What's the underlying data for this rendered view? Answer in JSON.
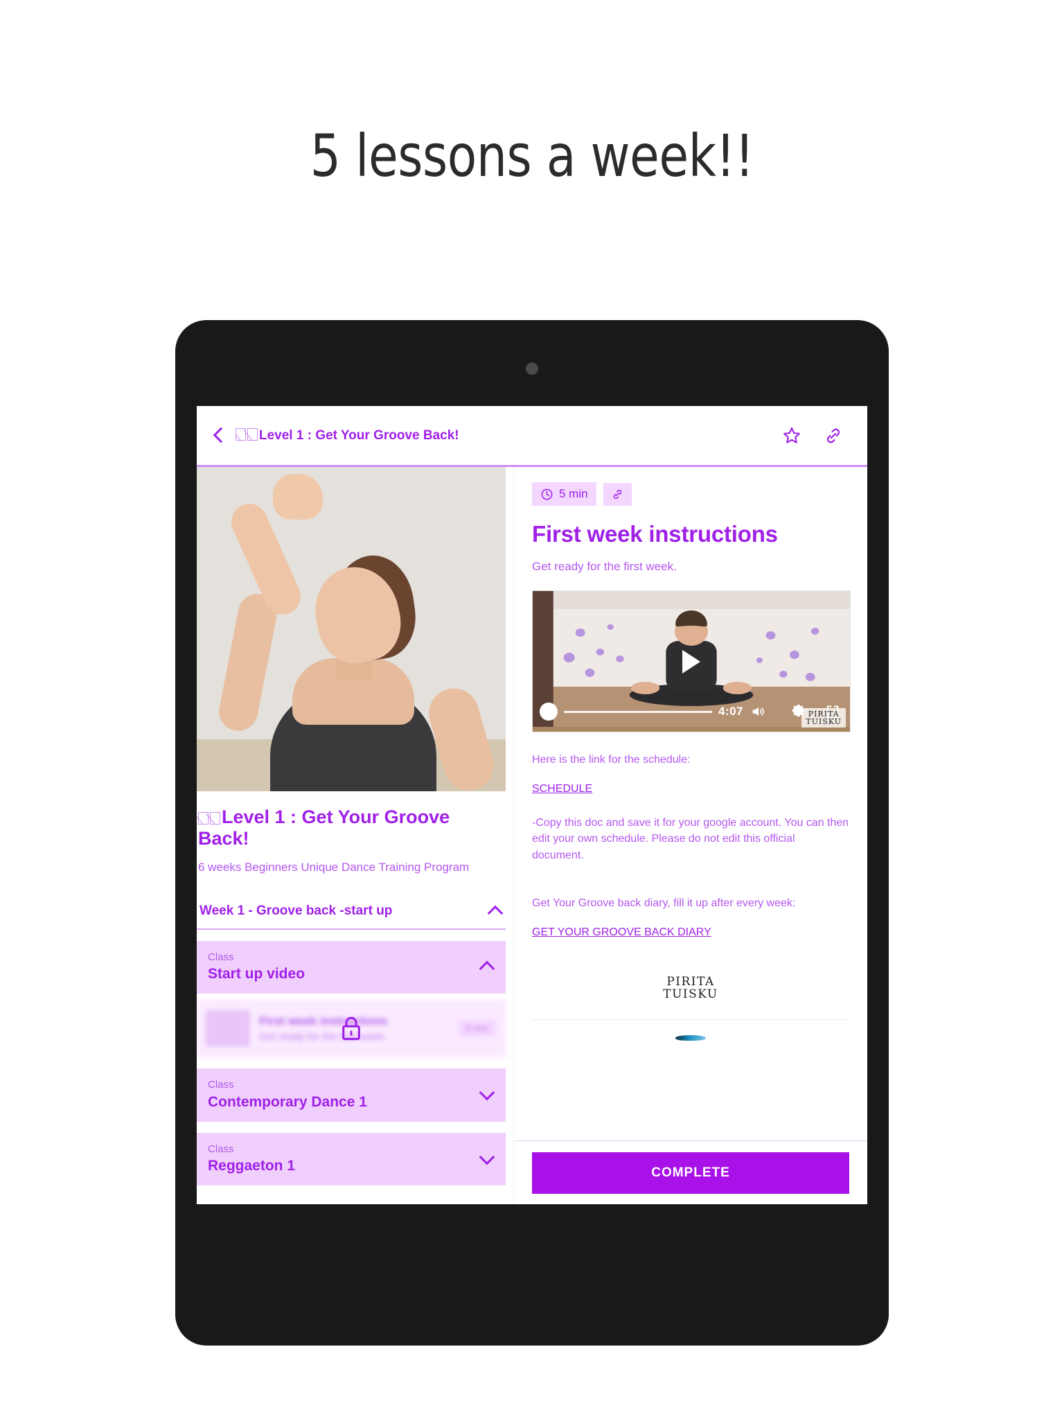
{
  "promo": {
    "heading": "5 lessons a week!!"
  },
  "device": {
    "type": "tablet",
    "camera": "camera-dot"
  },
  "appbar": {
    "back_icon": "back-chevron-icon",
    "title": "Level 1 : Get Your Groove Back!",
    "title_emoji_placeholder": "□□",
    "star_icon": "star-outline-icon",
    "link_icon": "link-icon"
  },
  "course": {
    "hero_alt": "woman flexing arm in dance studio",
    "title": "Level 1 : Get Your Groove Back!",
    "subtitle": "6 weeks Beginners Unique Dance Training Program",
    "week_section": {
      "label": "Week 1 - Groove back -start up",
      "chevron": "chevron-up-icon",
      "expanded": true
    },
    "classes": [
      {
        "kicker": "Class",
        "name": "Start up video",
        "chevron": "chevron-up-icon",
        "expanded": true
      },
      {
        "kicker": "Class",
        "name": "Contemporary Dance 1",
        "chevron": "chevron-down-icon",
        "expanded": false
      },
      {
        "kicker": "Class",
        "name": "Reggaeton 1",
        "chevron": "chevron-down-icon",
        "expanded": false
      }
    ],
    "locked_lesson": {
      "title": "First week instructions",
      "subtitle": "Get ready for the first week.",
      "duration": "5 min",
      "lock_icon": "lock-icon",
      "blurred": true
    }
  },
  "lesson": {
    "duration_chip": {
      "icon": "clock-icon",
      "text": "5 min"
    },
    "link_chip_icon": "link-icon",
    "title": "First week instructions",
    "description": "Get ready for the first week.",
    "video": {
      "play_icon": "play-icon",
      "dot_icon": "player-dot-icon",
      "time": "4:07",
      "volume_icon": "volume-icon",
      "settings_icon": "gear-icon",
      "fullscreen_icon": "fullscreen-icon",
      "watermark_line1": "PIRITA",
      "watermark_line2": "TUISKU"
    },
    "body": [
      {
        "type": "text",
        "value": "Here is the link for the schedule:"
      },
      {
        "type": "link",
        "value": "SCHEDULE"
      },
      {
        "type": "text",
        "value": "-Copy this doc and save it for your google account. You can then edit your own schedule. Please do not edit this official document."
      },
      {
        "type": "text",
        "value": "Get Your Groove back diary, fill it up after every week:"
      },
      {
        "type": "link",
        "value": "GET YOUR GROOVE BACK DIARY"
      }
    ],
    "logo_line1": "PIRITA",
    "logo_line2": "TUISKU",
    "complete_label": "COMPLETE"
  },
  "colors": {
    "brand_purple": "#a020e8",
    "light_purple": "#b457ef",
    "chip_bg": "#f3d7ff",
    "card_bg": "#f0cffc",
    "button_purple": "#a811e8",
    "device_black": "#191919"
  }
}
